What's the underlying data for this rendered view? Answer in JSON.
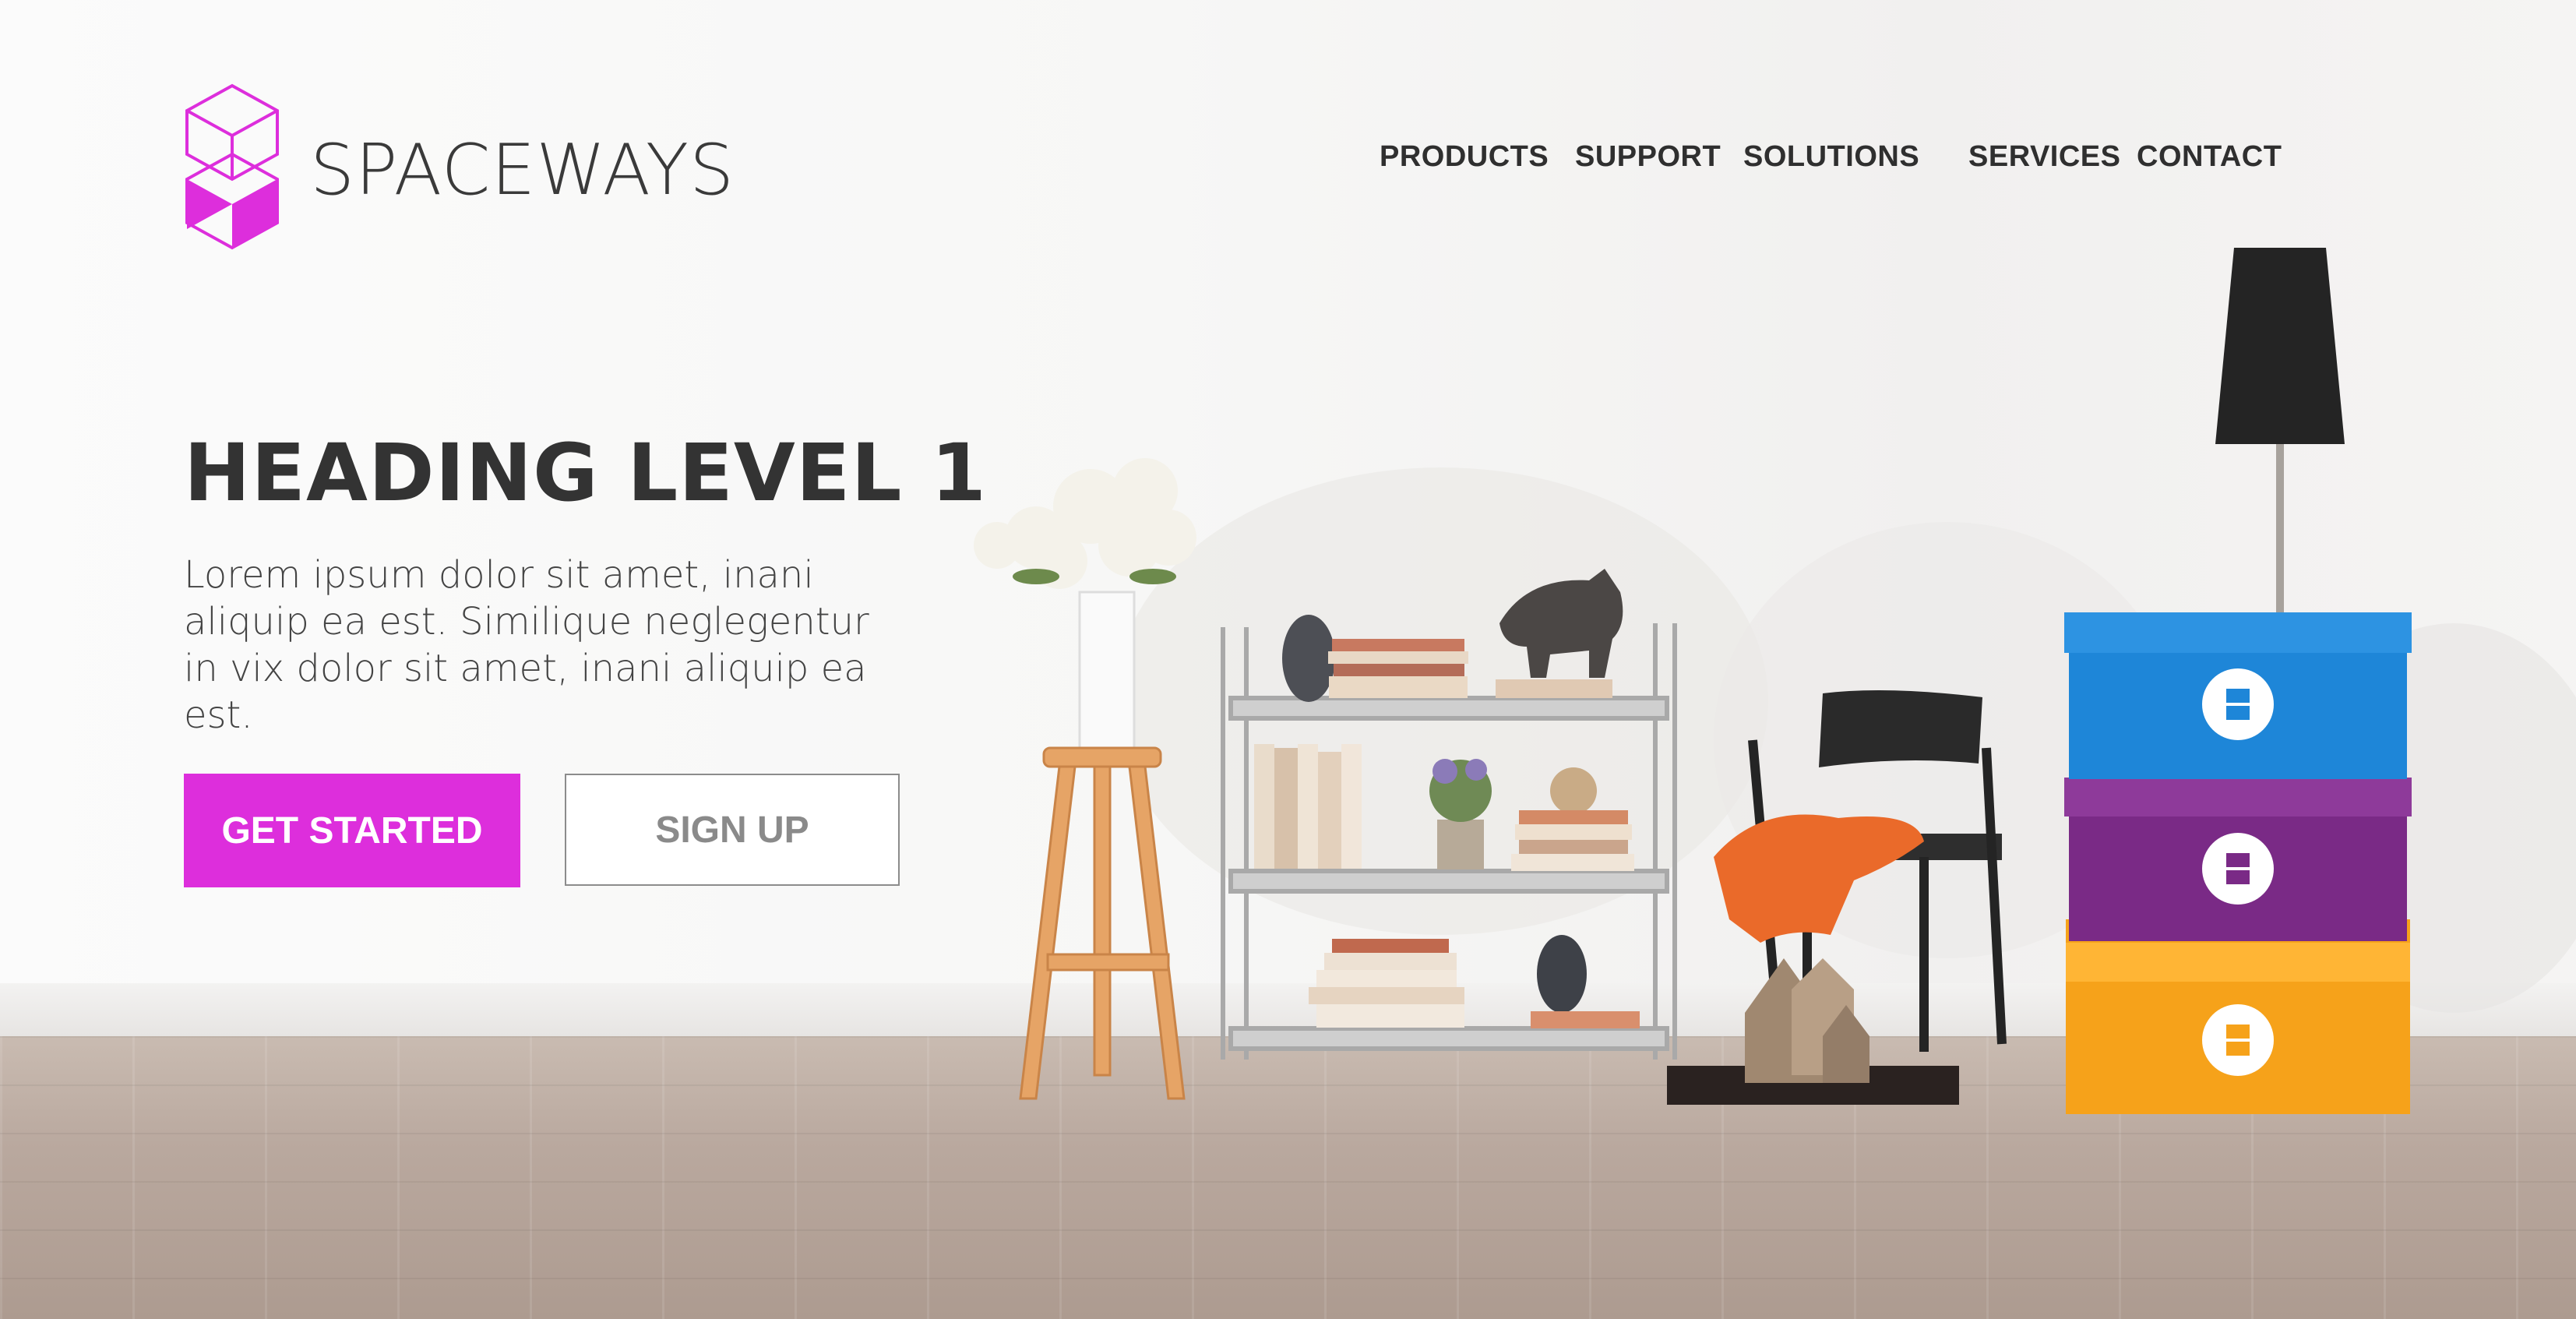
{
  "brand": {
    "name": "SPACEWAYS",
    "logo_color": "#dd2edc"
  },
  "nav": {
    "items": [
      {
        "label": "PRODUCTS"
      },
      {
        "label": "SUPPORT"
      },
      {
        "label": "SOLUTIONS"
      },
      {
        "label": "SERVICES"
      },
      {
        "label": "CONTACT"
      }
    ]
  },
  "hero": {
    "title": "HEADING LEVEL 1",
    "text": "Lorem ipsum dolor sit amet, inani aliquip ea est. Similique neglegentur in vix dolor sit amet, inani aliquip ea est.",
    "primary_button": "GET STARTED",
    "secondary_button": "SIGN UP",
    "accent": "#dd2edc"
  },
  "scene": {
    "objects": [
      "flower-vase",
      "stool",
      "wire-shelf",
      "elephant-figurine",
      "chair",
      "orange-blanket",
      "lamp",
      "blue-crate",
      "purple-crate",
      "orange-crate"
    ],
    "crate_colors": [
      "#1e86d8",
      "#7a2a86",
      "#f6a21a"
    ]
  }
}
